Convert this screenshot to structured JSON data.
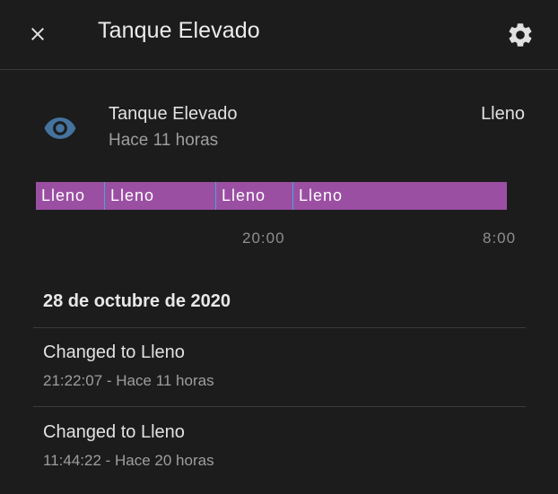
{
  "header": {
    "title": "Tanque Elevado",
    "close_icon": "close-icon",
    "settings_icon": "gear-icon"
  },
  "entity": {
    "name": "Tanque Elevado",
    "last_changed": "Hace 11 horas",
    "state": "Lleno",
    "icon": "eye-icon",
    "icon_color": "#44739e"
  },
  "timeline": {
    "bar_color": "#9b4fa3",
    "segments": [
      {
        "label": "Lleno"
      },
      {
        "label": "Lleno"
      },
      {
        "label": "Lleno"
      },
      {
        "label": "Lleno"
      }
    ],
    "ticks": [
      "20:00",
      "8:00"
    ]
  },
  "logbook": {
    "date": "28 de octubre de 2020",
    "entries": [
      {
        "message": "Changed to Lleno",
        "time": "21:22:07 - Hace 11 horas"
      },
      {
        "message": "Changed to Lleno",
        "time": "11:44:22 - Hace 20 horas"
      }
    ]
  }
}
